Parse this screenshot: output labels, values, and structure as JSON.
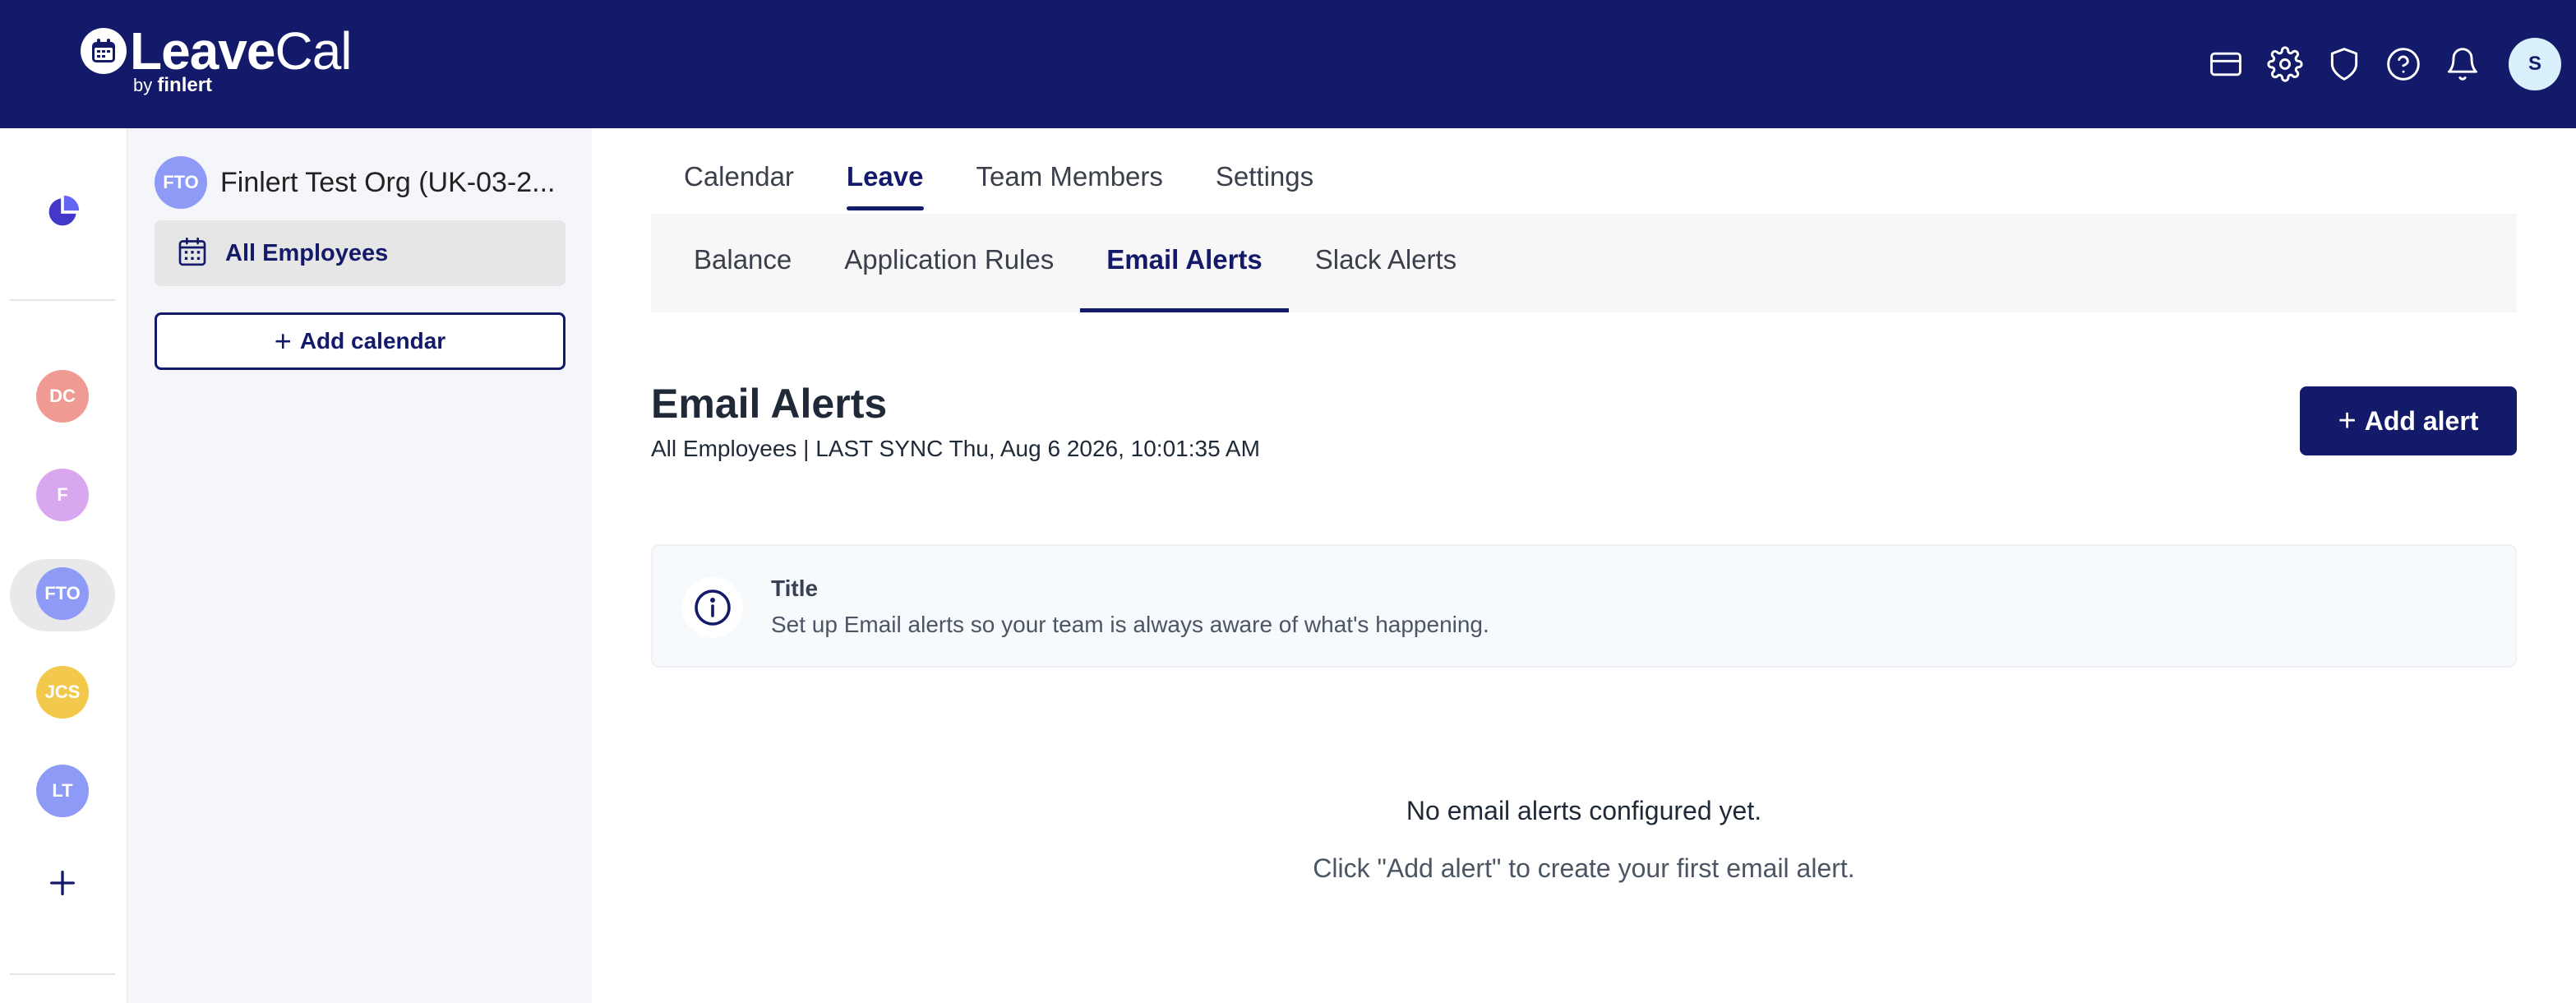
{
  "brand": {
    "name_bold": "Leave",
    "name_light": "Cal",
    "by": "by",
    "by_brand": "finlert"
  },
  "topbar": {
    "icons": [
      "card-icon",
      "gear-icon",
      "shield-icon",
      "help-icon",
      "bell-icon"
    ],
    "avatar": "S"
  },
  "rail": {
    "orgs": [
      {
        "initials": "DC",
        "color": "#ef9a92"
      },
      {
        "initials": "F",
        "color": "#d9a6f0"
      },
      {
        "initials": "FTO",
        "color": "#8d9bf7"
      },
      {
        "initials": "JCS",
        "color": "#f2c94c"
      },
      {
        "initials": "LT",
        "color": "#8d9bf7"
      }
    ]
  },
  "calendar_panel": {
    "org_initials": "FTO",
    "org_name": "Finlert Test Org (UK-03-2...",
    "calendar_item": "All Employees",
    "add_calendar": "Add calendar"
  },
  "tabs": [
    "Calendar",
    "Leave",
    "Team Members",
    "Settings"
  ],
  "active_tab": "Leave",
  "subtabs": [
    "Balance",
    "Application Rules",
    "Email Alerts",
    "Slack Alerts"
  ],
  "active_subtab": "Email Alerts",
  "page": {
    "title": "Email Alerts",
    "subline": "All Employees | LAST SYNC Thu, Aug 6 2026, 10:01:35 AM",
    "add_alert": "Add alert"
  },
  "info": {
    "title": "Title",
    "text": "Set up Email alerts so your team is always aware of what's happening."
  },
  "empty": {
    "main": "No email alerts configured yet.",
    "sub": "Click \"Add alert\" to create your first email alert."
  },
  "colors": {
    "navy": "#141a6a",
    "panel": "#f5f6fa"
  }
}
